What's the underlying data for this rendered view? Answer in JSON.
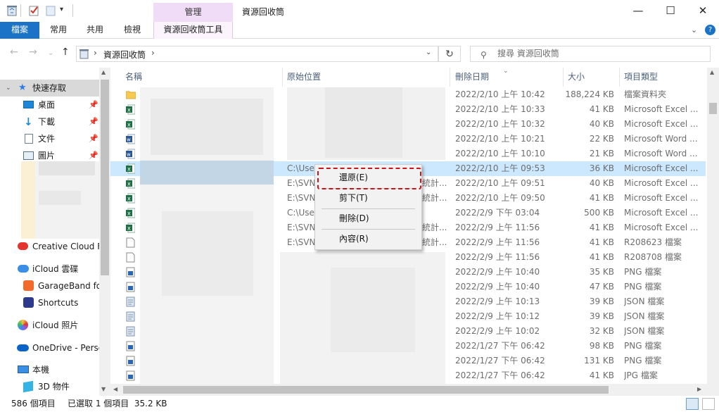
{
  "window": {
    "title": "資源回收筒",
    "context_tab": "管理",
    "min_glyph": "—",
    "max_glyph": "☐",
    "close_glyph": "✕"
  },
  "ribbon": {
    "file_tab": "檔案",
    "tabs": [
      "常用",
      "共用",
      "檢視"
    ],
    "tools_tab": "資源回收筒工具",
    "help_glyph": "?",
    "collapse_glyph": "⌄"
  },
  "address": {
    "path": "資源回收筒",
    "separator": "›",
    "search_placeholder": "搜尋 資源回收筒"
  },
  "sidebar": [
    {
      "label": "快速存取",
      "icon": "star-icon",
      "pinned": false
    },
    {
      "label": "桌面",
      "icon": "desktop-icon",
      "pinned": true
    },
    {
      "label": "下載",
      "icon": "download-icon",
      "pinned": true
    },
    {
      "label": "文件",
      "icon": "document-icon",
      "pinned": true
    },
    {
      "label": "圖片",
      "icon": "picture-icon",
      "pinned": true
    },
    {
      "label": "Creative Cloud Fi",
      "icon": "creative-cloud-icon",
      "pinned": false
    },
    {
      "label": "iCloud 雲碟",
      "icon": "icloud-icon",
      "pinned": false
    },
    {
      "label": "GarageBand fo",
      "icon": "garageband-icon",
      "pinned": false
    },
    {
      "label": "Shortcuts",
      "icon": "shortcuts-icon",
      "pinned": false
    },
    {
      "label": "iCloud 照片",
      "icon": "icloud-photos-icon",
      "pinned": false
    },
    {
      "label": "OneDrive - Perso",
      "icon": "onedrive-icon",
      "pinned": false
    },
    {
      "label": "本機",
      "icon": "computer-icon",
      "pinned": false
    },
    {
      "label": "3D 物件",
      "icon": "3d-objects-icon",
      "pinned": false
    }
  ],
  "columns": [
    "名稱",
    "原始位置",
    "刪除日期",
    "大小",
    "項目類型"
  ],
  "rows": [
    {
      "location": "",
      "date": "2022/2/10 上午 10:42",
      "size": "188,224 KB",
      "type": "檔案資料夾",
      "icon": "folder-icon"
    },
    {
      "location": "",
      "date": "2022/2/10 上午 10:33",
      "size": "41 KB",
      "type": "Microsoft Excel ...",
      "icon": "excel-icon"
    },
    {
      "location": "",
      "date": "2022/2/10 上午 10:32",
      "size": "40 KB",
      "type": "Microsoft Excel ...",
      "icon": "excel-icon"
    },
    {
      "location": "",
      "date": "2022/2/10 上午 10:21",
      "size": "22 KB",
      "type": "Microsoft Word ...",
      "icon": "word-icon"
    },
    {
      "location": "",
      "date": "2022/2/10 上午 10:10",
      "size": "21 KB",
      "type": "Microsoft Word ...",
      "icon": "word-icon"
    },
    {
      "location": "C:\\User",
      "date": "2022/2/10 上午 09:53",
      "size": "36 KB",
      "type": "Microsoft Excel ...",
      "icon": "excel-icon",
      "selected": true
    },
    {
      "location": "E:\\SVN",
      "date": "2022/2/10 上午 09:51",
      "size": "40 KB",
      "type": "Microsoft Excel ...",
      "icon": "excel-icon",
      "loc_tail": "統計..."
    },
    {
      "location": "E:\\SVN",
      "date": "2022/2/10 上午 09:50",
      "size": "41 KB",
      "type": "Microsoft Excel ...",
      "icon": "excel-icon",
      "loc_tail": "統計..."
    },
    {
      "location": "C:\\User",
      "date": "2022/2/9 下午 03:04",
      "size": "500 KB",
      "type": "Microsoft Excel ...",
      "icon": "excel-icon"
    },
    {
      "location": "E:\\SVN",
      "date": "2022/2/9 上午 11:56",
      "size": "41 KB",
      "type": "Microsoft Excel ...",
      "icon": "excel-icon",
      "loc_tail": "統計..."
    },
    {
      "location": "E:\\SVN",
      "date": "2022/2/9 上午 11:56",
      "size": "41 KB",
      "type": "R208623 檔案",
      "icon": "blank-file-icon",
      "loc_tail": "統計..."
    },
    {
      "location": "",
      "date": "2022/2/9 上午 11:56",
      "size": "41 KB",
      "type": "R208708 檔案",
      "icon": "blank-file-icon"
    },
    {
      "location": "",
      "date": "2022/2/9 上午 10:40",
      "size": "35 KB",
      "type": "PNG 檔案",
      "icon": "image-file-icon"
    },
    {
      "location": "",
      "date": "2022/2/9 上午 10:40",
      "size": "47 KB",
      "type": "PNG 檔案",
      "icon": "image-file-icon"
    },
    {
      "location": "",
      "date": "2022/2/9 上午 10:13",
      "size": "39 KB",
      "type": "JSON 檔案",
      "icon": "json-file-icon"
    },
    {
      "location": "",
      "date": "2022/2/9 上午 10:12",
      "size": "39 KB",
      "type": "JSON 檔案",
      "icon": "json-file-icon"
    },
    {
      "location": "",
      "date": "2022/2/9 上午 10:02",
      "size": "32 KB",
      "type": "JSON 檔案",
      "icon": "json-file-icon"
    },
    {
      "location": "",
      "date": "2022/1/27 下午 06:42",
      "size": "98 KB",
      "type": "PNG 檔案",
      "icon": "image-file-icon"
    },
    {
      "location": "",
      "date": "2022/1/27 下午 06:42",
      "size": "131 KB",
      "type": "PNG 檔案",
      "icon": "image-file-icon"
    },
    {
      "location": "",
      "date": "2022/1/27 下午 06:42",
      "size": "41 KB",
      "type": "JPG 檔案",
      "icon": "image-file-icon"
    }
  ],
  "context_menu": [
    {
      "label": "還原(E)",
      "highlighted": true
    },
    {
      "label": "剪下(T)"
    },
    {
      "label": "刪除(D)"
    },
    {
      "label": "內容(R)"
    }
  ],
  "status": {
    "count": "586 個項目",
    "selection": "已選取 1 個項目  35.2 KB"
  },
  "colors": {
    "file_tab": "#1a73c7",
    "context_tab": "#f0dcf7",
    "selection": "#cce8ff",
    "highlight_border": "#c6161b",
    "excel": "#1d7044",
    "word": "#2b5797"
  }
}
